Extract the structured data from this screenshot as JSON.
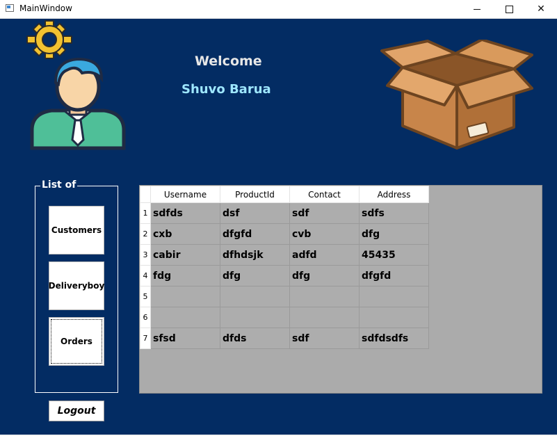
{
  "window": {
    "title": "MainWindow",
    "minimize_glyph": "",
    "maximize_glyph": "",
    "close_glyph": "✕"
  },
  "header": {
    "welcome": "Welcome",
    "username": "Shuvo Barua"
  },
  "icons": [
    "gear-icon",
    "user-avatar-icon",
    "package-box-icon"
  ],
  "sidebar": {
    "group_label": "List of",
    "buttons": {
      "customers": "Customers",
      "deliveryboy": "Deliveryboy",
      "orders": "Orders"
    },
    "logout": "Logout"
  },
  "table": {
    "columns": [
      "Username",
      "ProductId",
      "Contact",
      "Address"
    ],
    "rows": [
      {
        "num": "1",
        "cells": [
          "sdfds",
          "dsf",
          "sdf",
          "sdfs"
        ]
      },
      {
        "num": "2",
        "cells": [
          "cxb",
          "dfgfd",
          "cvb",
          "dfg"
        ]
      },
      {
        "num": "3",
        "cells": [
          "cabir",
          "dfhdsjk",
          "adfd",
          "45435"
        ]
      },
      {
        "num": "4",
        "cells": [
          "fdg",
          "dfg",
          "dfg",
          "dfgfd"
        ]
      },
      {
        "num": "5",
        "cells": [
          "",
          "",
          "",
          ""
        ]
      },
      {
        "num": "6",
        "cells": [
          "",
          "",
          "",
          ""
        ]
      },
      {
        "num": "7",
        "cells": [
          "sfsd",
          "dfds",
          "sdf",
          "sdfdsdfs"
        ]
      }
    ]
  },
  "colors": {
    "background": "#032c63",
    "welcome_text": "#e7e7e7",
    "username_text": "#9ee7ff",
    "grid_background": "#ababab"
  }
}
